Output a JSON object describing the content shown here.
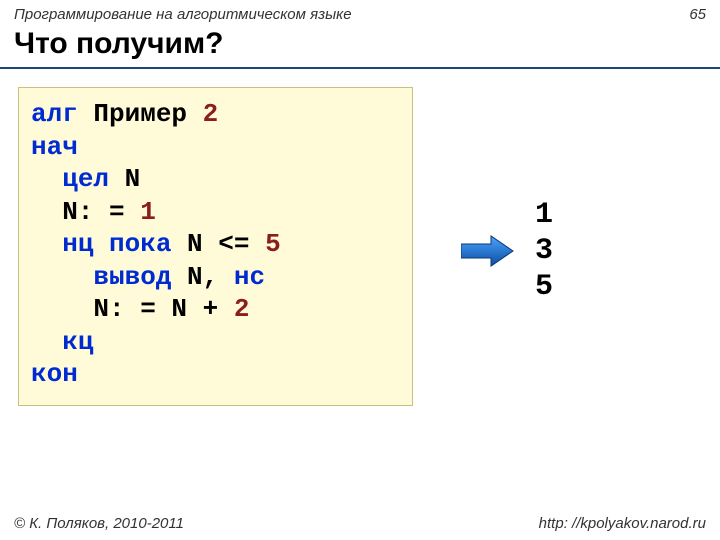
{
  "header": {
    "subject": "Программирование на алгоритмическом языке",
    "page": "65"
  },
  "title": "Что получим?",
  "code": {
    "l1_kw": "алг",
    "l1_rest": " Пример ",
    "l1_num": "2",
    "l2": "нач",
    "l3_kw": "цел",
    "l3_rest": " N",
    "l4_a": "  N: = ",
    "l4_num": "1",
    "l5_kw": "нц пока",
    "l5_mid": " N <= ",
    "l5_num": "5",
    "l6_kw": "вывод",
    "l6_rest": " N, ",
    "l6_kw2": "нс",
    "l7_a": "    N: = N + ",
    "l7_num": "2",
    "l8": "кц",
    "l9": "кон"
  },
  "output": {
    "line1": "1",
    "line2": "3",
    "line3": "5"
  },
  "footer": {
    "left": "© К. Поляков, 2010-2011",
    "right": "http: //kpolyakov.narod.ru"
  }
}
